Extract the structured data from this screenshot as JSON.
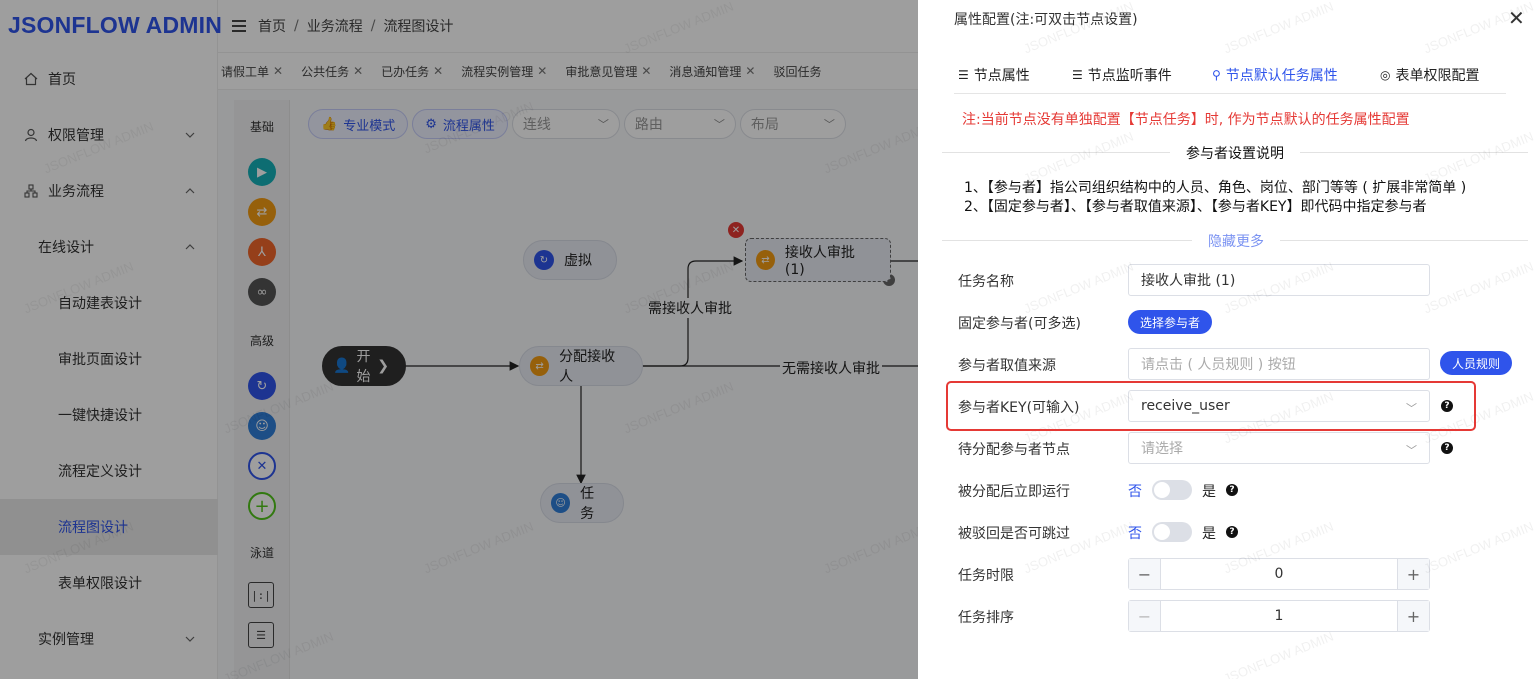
{
  "app": {
    "logo": "JSONFLOW ADMIN",
    "watermark": "JSONFLOW ADMIN"
  },
  "sidebar": {
    "items": [
      {
        "label": "首页",
        "icon": "home-icon"
      },
      {
        "label": "权限管理",
        "icon": "user-icon"
      },
      {
        "label": "业务流程",
        "icon": "flow-icon"
      },
      {
        "label": "在线设计"
      },
      {
        "label": "自动建表设计"
      },
      {
        "label": "审批页面设计"
      },
      {
        "label": "一键快捷设计"
      },
      {
        "label": "流程定义设计"
      },
      {
        "label": "流程图设计",
        "active": true
      },
      {
        "label": "表单权限设计"
      },
      {
        "label": "实例管理"
      }
    ]
  },
  "breadcrumb": [
    "首页",
    "业务流程",
    "流程图设计"
  ],
  "tabs": [
    "请假工单",
    "公共任务",
    "已办任务",
    "流程实例管理",
    "审批意见管理",
    "消息通知管理",
    "驳回任务"
  ],
  "designer": {
    "palette": {
      "basic": "基础",
      "advanced": "高级",
      "lane": "泳道"
    },
    "toolbar": {
      "pro_mode": "专业模式",
      "flow_attr": "流程属性",
      "line_placeholder": "连线",
      "route_placeholder": "路由",
      "layout_placeholder": "布局"
    },
    "nodes": {
      "start": "开始",
      "virtual": "虚拟",
      "assign": "分配接收人",
      "receive": "接收人审批 (1)",
      "task": "任务"
    },
    "edges": {
      "need_approval": "需接收人审批",
      "no_approval": "无需接收人审批"
    }
  },
  "drawer": {
    "title": "属性配置(注:可双击节点设置)",
    "tabs": [
      "节点属性",
      "节点监听事件",
      "节点默认任务属性",
      "表单权限配置"
    ],
    "active_tab": 2,
    "notice": "注:当前节点没有单独配置【节点任务】时, 作为节点默认的任务属性配置",
    "section_title": "参与者设置说明",
    "explain": [
      "1、【参与者】指公司组织结构中的人员、角色、岗位、部门等等 ( 扩展非常简单 )",
      "2、【固定参与者】、【参与者取值来源】、【参与者KEY】即代码中指定参与者"
    ],
    "hide_more": "隐藏更多",
    "form": {
      "task_name_label": "任务名称",
      "task_name_value": "接收人审批 (1)",
      "fixed_label": "固定参与者(可多选)",
      "select_btn": "选择参与者",
      "source_label": "参与者取值来源",
      "source_placeholder": "请点击 ( 人员规则 ) 按钮",
      "rule_btn": "人员规则",
      "key_label": "参与者KEY(可输入)",
      "key_value": "receive_user",
      "pending_label": "待分配参与者节点",
      "pending_placeholder": "请选择",
      "run_label": "被分配后立即运行",
      "skip_label": "被驳回是否可跳过",
      "no": "否",
      "yes": "是",
      "run_value": false,
      "skip_value": false,
      "limit_label": "任务时限",
      "limit_value": "0",
      "order_label": "任务排序",
      "order_value": "1"
    }
  },
  "colors": {
    "accent": "#2f54eb",
    "danger": "#e53935"
  }
}
